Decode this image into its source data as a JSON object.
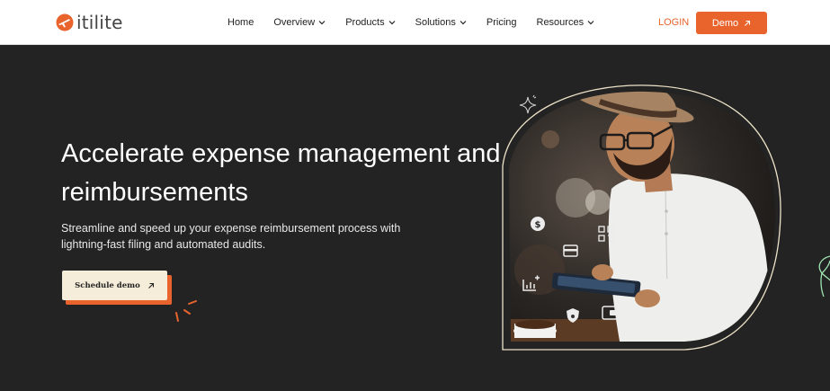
{
  "brand": {
    "name": "itilite",
    "accent": "#e8642c"
  },
  "nav": {
    "items": [
      {
        "label": "Home",
        "dropdown": false
      },
      {
        "label": "Overview",
        "dropdown": true
      },
      {
        "label": "Products",
        "dropdown": true
      },
      {
        "label": "Solutions",
        "dropdown": true
      },
      {
        "label": "Pricing",
        "dropdown": false
      },
      {
        "label": "Resources",
        "dropdown": true
      }
    ],
    "login_label": "LOGIN",
    "demo_label": "Demo"
  },
  "hero": {
    "title_line1": "Accelerate expense management and",
    "title_line2": "reimbursements",
    "subtitle": "Streamline and speed up your expense reimbursement process with lightning-fast filing and automated audits.",
    "cta_label": "Schedule demo"
  },
  "hero_image": {
    "floating_icons": [
      "dollar-icon",
      "qr-code-icon",
      "credit-card-icon",
      "chart-plus-icon",
      "shield-icon",
      "wallet-icon"
    ]
  }
}
